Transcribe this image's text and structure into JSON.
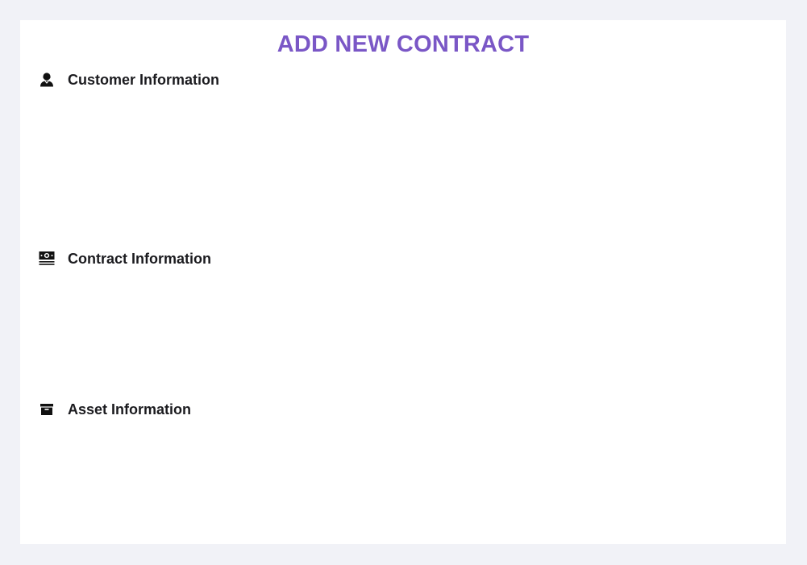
{
  "page": {
    "title": "ADD NEW CONTRACT",
    "title_color": "#7a57c6",
    "background": "#f1f2f7",
    "card_background": "#ffffff"
  },
  "sections": [
    {
      "title": "Customer Information",
      "icon": "user-icon"
    },
    {
      "title": "Contract Information",
      "icon": "money-icon"
    },
    {
      "title": "Asset Information",
      "icon": "archive-box-icon"
    }
  ]
}
